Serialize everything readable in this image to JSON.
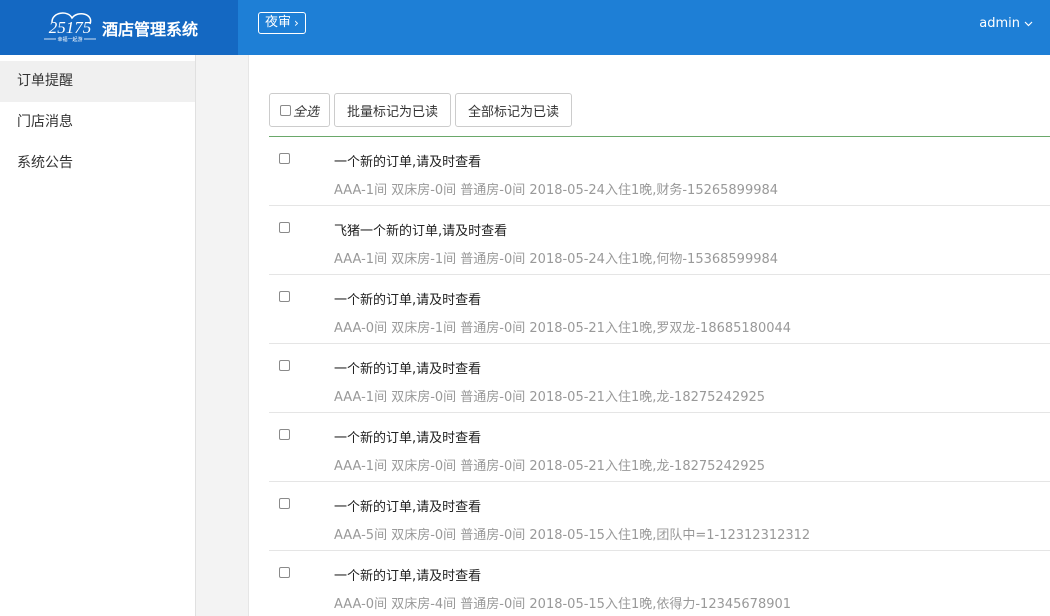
{
  "header": {
    "logo_text": "25175",
    "logo_sub": "幸福一起游",
    "app_title": "酒店管理系统",
    "night_audit_label": "夜审",
    "user_name": "admin"
  },
  "sidebar": {
    "items": [
      {
        "label": "订单提醒",
        "active": true
      },
      {
        "label": "门店消息",
        "active": false
      },
      {
        "label": "系统公告",
        "active": false
      }
    ]
  },
  "toolbar": {
    "select_all_label": "全选",
    "batch_mark_label": "批量标记为已读",
    "mark_all_label": "全部标记为已读"
  },
  "messages": [
    {
      "title": "一个新的订单,请及时查看",
      "detail": "AAA-1间 双床房-0间 普通房-0间 2018-05-24入住1晚,财务-15265899984"
    },
    {
      "title": "飞猪一个新的订单,请及时查看",
      "detail": "AAA-1间 双床房-1间 普通房-0间 2018-05-24入住1晚,何物-15368599984"
    },
    {
      "title": "一个新的订单,请及时查看",
      "detail": "AAA-0间 双床房-1间 普通房-0间 2018-05-21入住1晚,罗双龙-18685180044"
    },
    {
      "title": "一个新的订单,请及时查看",
      "detail": "AAA-1间 双床房-0间 普通房-0间 2018-05-21入住1晚,龙-18275242925"
    },
    {
      "title": "一个新的订单,请及时查看",
      "detail": "AAA-1间 双床房-0间 普通房-0间 2018-05-21入住1晚,龙-18275242925"
    },
    {
      "title": "一个新的订单,请及时查看",
      "detail": "AAA-5间 双床房-0间 普通房-0间 2018-05-15入住1晚,团队中=1-12312312312"
    },
    {
      "title": "一个新的订单,请及时查看",
      "detail": "AAA-0间 双床房-4间 普通房-0间 2018-05-15入住1晚,依得力-12345678901"
    }
  ]
}
